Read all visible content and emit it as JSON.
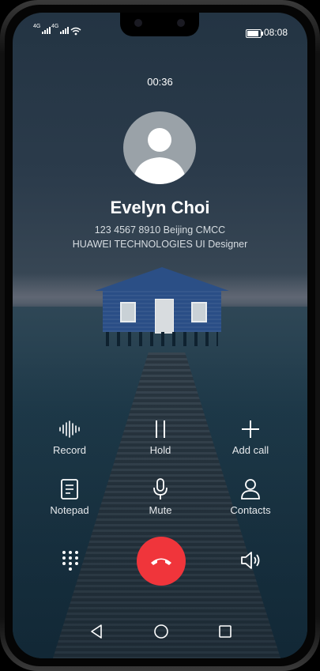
{
  "status_bar": {
    "sim1_tag": "4G",
    "sim2_tag": "4G",
    "battery_percent": 90,
    "time": "08:08"
  },
  "call": {
    "duration": "00:36",
    "contact_name": "Evelyn Choi",
    "phone_line": "123 4567 8910  Beijing CMCC",
    "title_line": "HUAWEI TECHNOLOGIES UI Designer"
  },
  "actions": {
    "record": "Record",
    "hold": "Hold",
    "add_call": "Add call",
    "notepad": "Notepad",
    "mute": "Mute",
    "contacts": "Contacts"
  },
  "colors": {
    "end_call": "#f0353b",
    "accent_text": "#ffffff"
  },
  "icons": {
    "record": "waveform-icon",
    "hold": "pause-icon",
    "add_call": "plus-icon",
    "notepad": "notepad-icon",
    "mute": "microphone-icon",
    "contacts": "person-icon",
    "dialpad": "dialpad-icon",
    "end_call": "end-call-icon",
    "speaker": "speaker-icon",
    "nav_back": "back-icon",
    "nav_home": "home-icon",
    "nav_recent": "recent-apps-icon"
  }
}
